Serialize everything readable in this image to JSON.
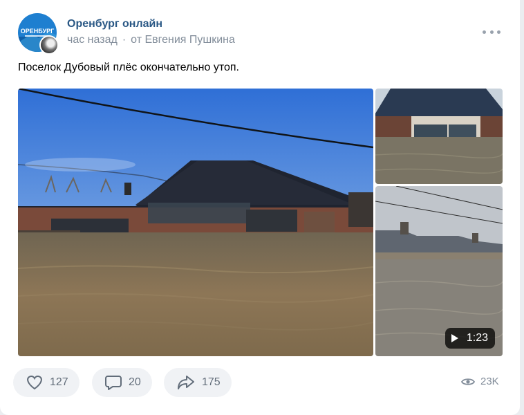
{
  "post": {
    "author": "Оренбург онлайн",
    "time": "час назад",
    "separator": "·",
    "source": "от Евгения Пушкина",
    "text": "Поселок Дубовый плёс окончательно утоп.",
    "avatar_text": "ОРЕНБУРГ"
  },
  "media": {
    "video_duration": "1:23"
  },
  "actions": {
    "likes": "127",
    "comments": "20",
    "shares": "175",
    "views": "23K"
  },
  "colors": {
    "link": "#2a5885",
    "secondary": "#818c99",
    "action_bg": "#f0f2f5",
    "action_text": "#626d7a"
  },
  "icons": [
    "more-icon",
    "heart-icon",
    "comment-icon",
    "share-icon",
    "eye-icon",
    "play-icon"
  ]
}
